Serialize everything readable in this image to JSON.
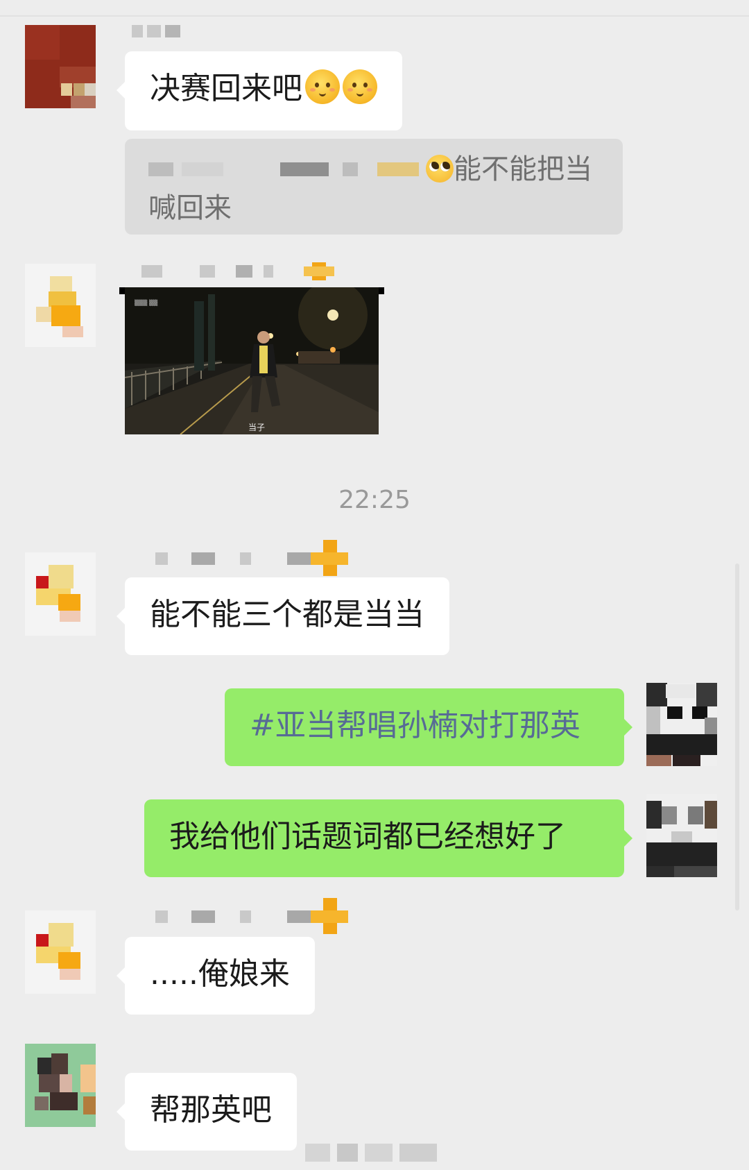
{
  "messages": [
    {
      "side": "left",
      "text": "决赛回来吧",
      "emoji": [
        "relieved-face-emoji",
        "relieved-face-emoji"
      ]
    },
    {
      "type": "quote",
      "text_end": "能不能把当",
      "text_line2": "喊回来",
      "emoji": "pleading-face-emoji"
    },
    {
      "side": "left",
      "type": "video",
      "caption": "当子"
    },
    {
      "side": "left",
      "text": "能不能三个都是当当"
    },
    {
      "side": "right",
      "text": "#亚当帮唱孙楠对打那英"
    },
    {
      "side": "right",
      "text": "我给他们话题词都已经想好了"
    },
    {
      "side": "left",
      "text": ".....俺娘来"
    },
    {
      "side": "left",
      "text": "帮那英吧"
    }
  ],
  "timestamp": "22:25",
  "colors": {
    "background": "#ededed",
    "bubble_left": "#ffffff",
    "bubble_right": "#95ec69",
    "topic_link": "#576b95",
    "quote_bg": "#dcdcdc"
  }
}
